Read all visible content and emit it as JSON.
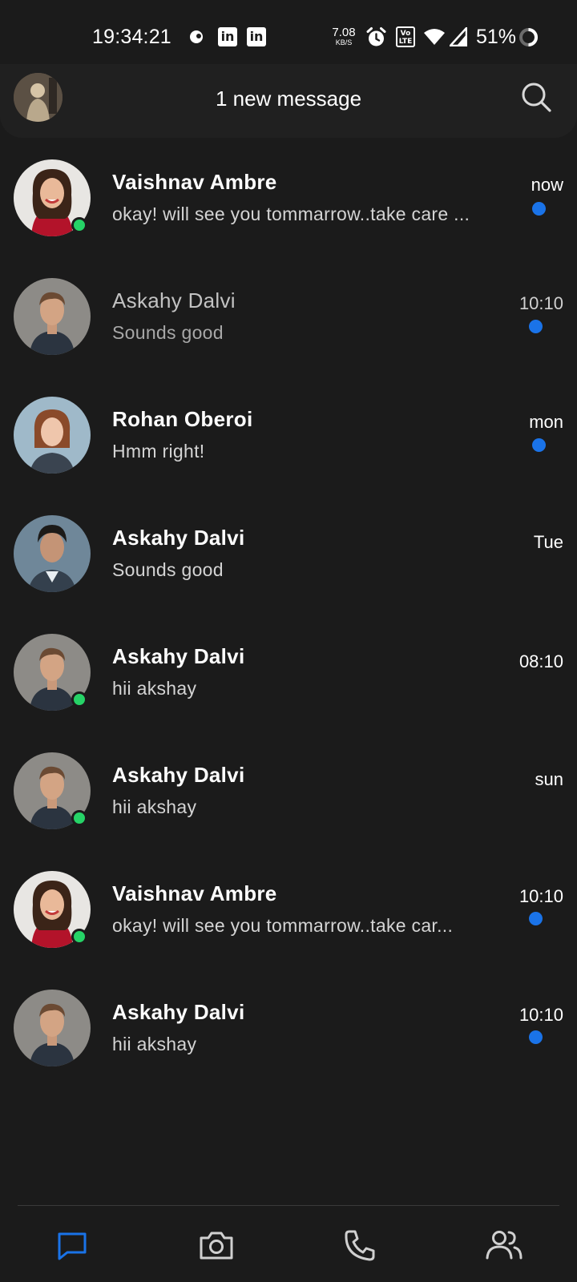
{
  "status_bar": {
    "time": "19:34:21",
    "net_speed_value": "7.08",
    "net_speed_unit": "KB/S",
    "volte_label": "Vo LTE",
    "battery_percent": "51%",
    "icons": [
      "notification-dot-icon",
      "linkedin-icon",
      "linkedin-icon",
      "alarm-icon",
      "volte-icon",
      "wifi-icon",
      "signal-icon",
      "battery-icon"
    ]
  },
  "header": {
    "title": "1 new message",
    "search_icon": "search-icon"
  },
  "chats": [
    {
      "name": "Vaishnav Ambre",
      "message": "okay! will see you tommarrow..take care ...",
      "time": "now",
      "unread": true,
      "online": true
    },
    {
      "name": "Askahy Dalvi",
      "message": "Sounds good",
      "time": "10:10",
      "unread": true,
      "online": false
    },
    {
      "name": "Rohan Oberoi",
      "message": "Hmm right!",
      "time": "mon",
      "unread": true,
      "online": false
    },
    {
      "name": "Askahy Dalvi",
      "message": "Sounds good",
      "time": "Tue",
      "unread": false,
      "online": false
    },
    {
      "name": "Askahy Dalvi",
      "message": "hii akshay",
      "time": "08:10",
      "unread": false,
      "online": true
    },
    {
      "name": "Askahy Dalvi",
      "message": "hii akshay",
      "time": "sun",
      "unread": false,
      "online": true
    },
    {
      "name": "Vaishnav Ambre",
      "message": "okay! will see you tommarrow..take car...",
      "time": "10:10",
      "unread": true,
      "online": true
    },
    {
      "name": "Askahy Dalvi",
      "message": "hii akshay",
      "time": "10:10",
      "unread": true,
      "online": false
    }
  ],
  "bottom_nav": [
    {
      "icon": "chat-icon",
      "active": true
    },
    {
      "icon": "camera-icon",
      "active": false
    },
    {
      "icon": "phone-icon",
      "active": false
    },
    {
      "icon": "people-icon",
      "active": false
    }
  ],
  "colors": {
    "background": "#1b1b1b",
    "header_background": "#202020",
    "accent": "#1a73e8",
    "online": "#26d367"
  }
}
